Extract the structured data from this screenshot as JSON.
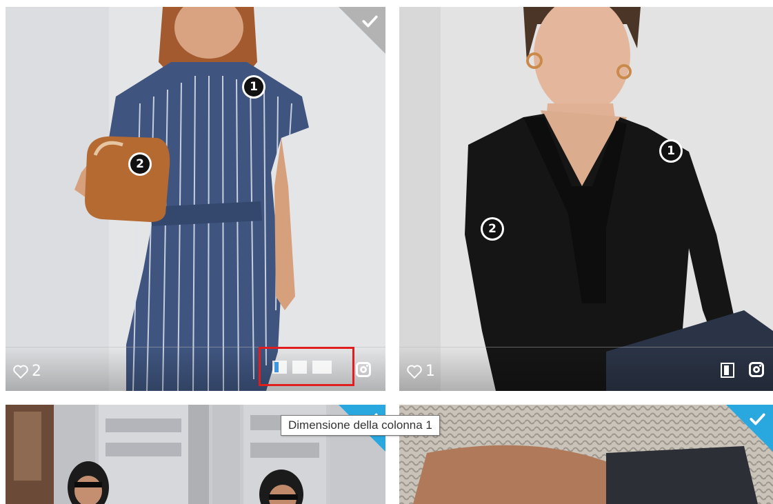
{
  "gallery": {
    "items": [
      {
        "likes": "2",
        "selected": true,
        "hotspots": [
          "1",
          "2"
        ],
        "icons": [
          "heart-icon",
          "column-size-picker",
          "instagram-icon",
          "checkmark-icon"
        ]
      },
      {
        "likes": "1",
        "selected": false,
        "hotspots": [
          "1",
          "2"
        ],
        "icons": [
          "heart-icon",
          "column-indicator-icon",
          "instagram-icon"
        ]
      },
      {
        "selected": true,
        "icons": [
          "checkmark-icon"
        ]
      },
      {
        "selected": true,
        "icons": [
          "checkmark-icon"
        ]
      }
    ]
  },
  "size_picker": {
    "options": 3,
    "active_option": 1
  },
  "tooltip": {
    "text": "Dimensione della colonna 1"
  },
  "colors": {
    "selected_corner": "#29a8e0",
    "unselected_corner": "#aaaaaa",
    "active_size": "#1e88e5",
    "highlight_border": "#e01e1e"
  }
}
